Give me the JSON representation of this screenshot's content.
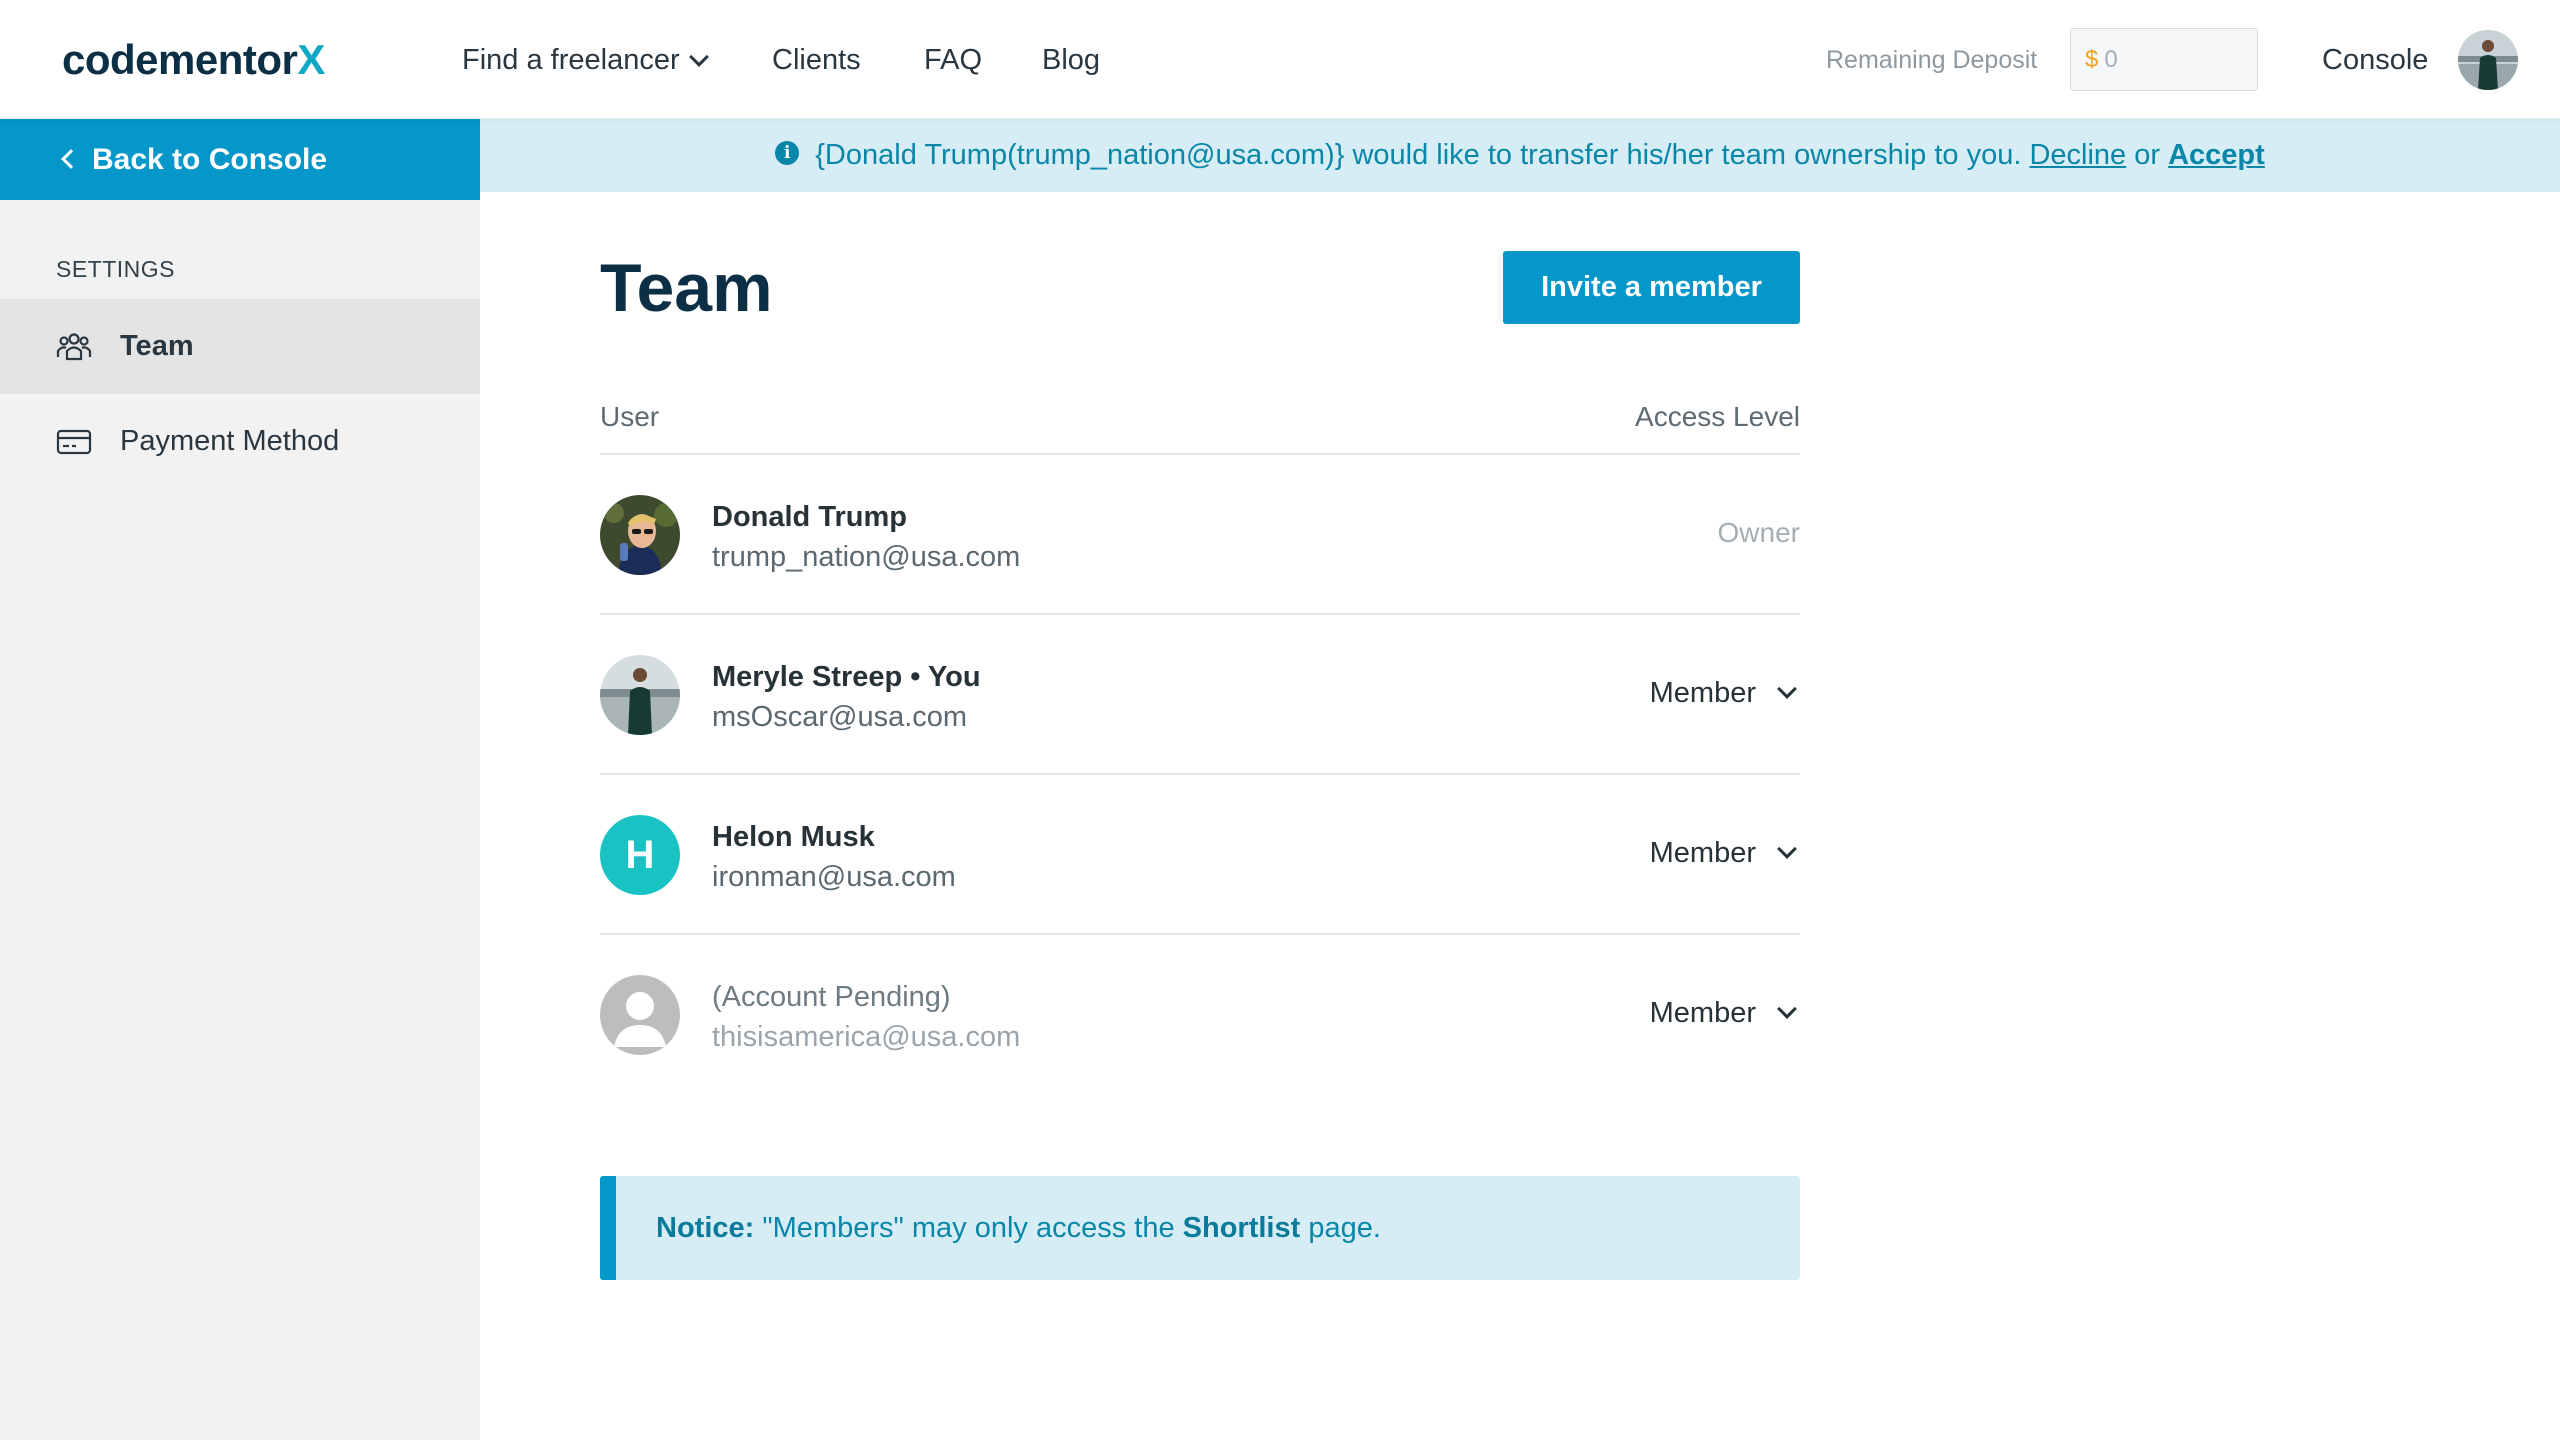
{
  "header": {
    "logo_main": "codementor",
    "logo_accent": "X",
    "nav": [
      {
        "label": "Find a freelancer",
        "dropdown": true
      },
      {
        "label": "Clients"
      },
      {
        "label": "FAQ"
      },
      {
        "label": "Blog"
      }
    ],
    "deposit_label": "Remaining Deposit",
    "deposit_currency": "$",
    "deposit_value": "0",
    "console_label": "Console"
  },
  "sidebar": {
    "back_label": "Back to Console",
    "section_label": "SETTINGS",
    "items": [
      {
        "label": "Team",
        "icon": "team-icon",
        "active": true
      },
      {
        "label": "Payment Method",
        "icon": "credit-card-icon",
        "active": false
      }
    ]
  },
  "banner": {
    "message": "{Donald Trump(trump_nation@usa.com)} would like to transfer his/her team ownership to you.",
    "decline_label": "Decline",
    "or_label": "or",
    "accept_label": "Accept"
  },
  "main": {
    "title": "Team",
    "invite_label": "Invite a member",
    "columns": {
      "user": "User",
      "access": "Access Level"
    },
    "members": [
      {
        "name": "Donald Trump",
        "email": "trump_nation@usa.com",
        "access": "Owner",
        "editable": false,
        "avatar": "photo-avatar"
      },
      {
        "name": "Meryle Streep • You",
        "email": "msOscar@usa.com",
        "access": "Member",
        "editable": true,
        "avatar": "photo-avatar"
      },
      {
        "name": "Helon Musk",
        "email": "ironman@usa.com",
        "access": "Member",
        "editable": true,
        "avatar": "letter-avatar",
        "initial": "H"
      },
      {
        "name": "(Account Pending)",
        "email": "thisisamerica@usa.com",
        "access": "Member",
        "editable": true,
        "avatar": "placeholder-avatar"
      }
    ],
    "notice": {
      "prefix": "Notice:",
      "text_before": "\"Members\" may only access the",
      "highlight": "Shortlist",
      "text_after": "page."
    }
  },
  "colors": {
    "brand_dark": "#0c2f45",
    "brand_accent": "#11a8c8",
    "primary_button": "#0597c9",
    "banner_bg": "#d7edf5",
    "avatar_teal": "#19c3c3"
  }
}
